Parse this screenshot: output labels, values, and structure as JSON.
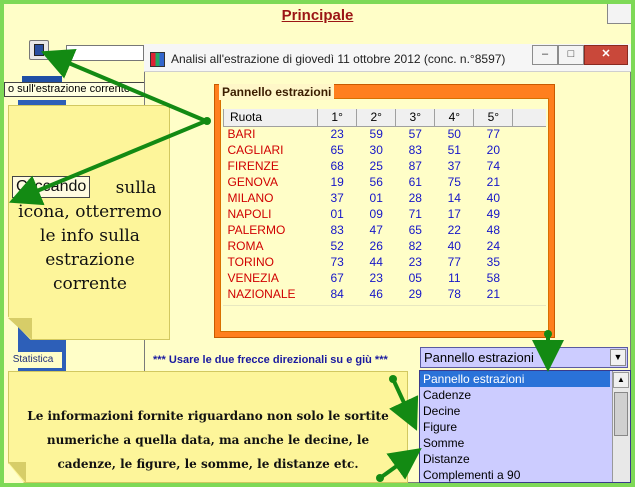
{
  "parent_window": {
    "title": "Principale"
  },
  "toolbar": {
    "tooltip": "o sull'estrazione corrente",
    "statistica_label": "Statistica"
  },
  "window": {
    "title": "Analisi all'estrazione di giovedì 11 ottobre 2012 (conc. n.°8597)",
    "min_label": "–",
    "max_label": "□",
    "close_label": "✕"
  },
  "panel": {
    "legend": "Pannello estrazioni",
    "columns": [
      "Ruota",
      "1°",
      "2°",
      "3°",
      "4°",
      "5°"
    ],
    "rows": [
      {
        "ruota": "BARI",
        "n": [
          "23",
          "59",
          "57",
          "50",
          "77"
        ]
      },
      {
        "ruota": "CAGLIARI",
        "n": [
          "65",
          "30",
          "83",
          "51",
          "20"
        ]
      },
      {
        "ruota": "FIRENZE",
        "n": [
          "68",
          "25",
          "87",
          "37",
          "74"
        ]
      },
      {
        "ruota": "GENOVA",
        "n": [
          "19",
          "56",
          "61",
          "75",
          "21"
        ]
      },
      {
        "ruota": "MILANO",
        "n": [
          "37",
          "01",
          "28",
          "14",
          "40"
        ]
      },
      {
        "ruota": "NAPOLI",
        "n": [
          "01",
          "09",
          "71",
          "17",
          "49"
        ]
      },
      {
        "ruota": "PALERMO",
        "n": [
          "83",
          "47",
          "65",
          "22",
          "48"
        ]
      },
      {
        "ruota": "ROMA",
        "n": [
          "52",
          "26",
          "82",
          "40",
          "24"
        ]
      },
      {
        "ruota": "TORINO",
        "n": [
          "73",
          "44",
          "23",
          "77",
          "35"
        ]
      },
      {
        "ruota": "VENEZIA",
        "n": [
          "67",
          "23",
          "05",
          "11",
          "58"
        ]
      },
      {
        "ruota": "NAZIONALE",
        "n": [
          "84",
          "46",
          "29",
          "78",
          "21"
        ]
      }
    ]
  },
  "hint": "*** Usare le due frecce direzionali su e giù ***",
  "dropdown": {
    "selected": "Pannello estrazioni",
    "options": [
      "Pannello estrazioni",
      "Cadenze",
      "Decine",
      "Figure",
      "Somme",
      "Distanze",
      "Complementi a 90"
    ]
  },
  "callout_icon": {
    "label": "Cliccando",
    "text": "sulla icona, otterremo le info sulla estrazione corrente"
  },
  "callout_info": {
    "text": "Le informazioni fornite riguardano non solo le sortite numeriche a quella data, ma anche le decine, le cadenze, le figure, le somme, le distanze etc."
  },
  "colors": {
    "frame_green": "#7ed957",
    "panel_orange": "#ff7f1e",
    "ruota_red": "#d00000",
    "number_blue": "#1515c8",
    "arrow_green": "#138a13",
    "selection_blue": "#2a72d8"
  }
}
